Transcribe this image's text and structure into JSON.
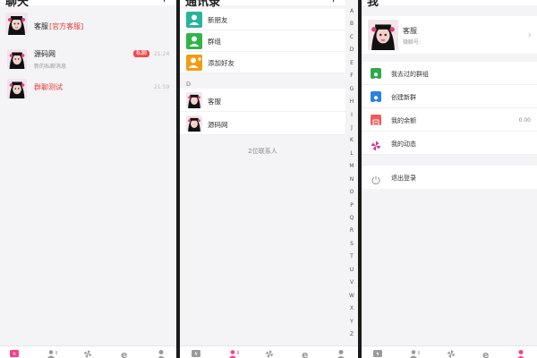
{
  "chats_screen": {
    "title": "聊天",
    "conversations": [
      {
        "name": "客服",
        "tag": "[官方客服]",
        "subtitle": "",
        "time": "",
        "badge": ""
      },
      {
        "name": "源码网",
        "tag": "",
        "subtitle": "新的私聊消息",
        "time": "21:24",
        "badge": "私聊"
      },
      {
        "name": "群聊测试",
        "tag": "",
        "subtitle": "",
        "time": "21:59",
        "badge": ""
      }
    ]
  },
  "contacts_screen": {
    "title": "通讯录",
    "function_items": [
      {
        "label": "新朋友",
        "color": "#27b39c"
      },
      {
        "label": "群组",
        "color": "#31b447"
      },
      {
        "label": "添加好友",
        "color": "#f39c12"
      }
    ],
    "section_letter": "D",
    "contacts": [
      {
        "label": "客服"
      },
      {
        "label": "源码网"
      }
    ],
    "contact_count": "2位联系人",
    "index_letters": [
      "A",
      "B",
      "C",
      "D",
      "E",
      "F",
      "G",
      "H",
      "I",
      "J",
      "K",
      "L",
      "M",
      "N",
      "O",
      "P",
      "Q",
      "R",
      "S",
      "T",
      "U",
      "V",
      "W",
      "X",
      "Y",
      "Z"
    ]
  },
  "me_screen": {
    "title": "我",
    "profile": {
      "name": "客服",
      "id_label": "微聊号:"
    },
    "menu": [
      {
        "label": "我去过的群组",
        "value": "",
        "color": "#2eaa4a"
      },
      {
        "label": "创建新群",
        "value": "",
        "color": "#2a82e4"
      },
      {
        "label": "我的余额",
        "value": "0.00",
        "color": "#ef5b5b"
      },
      {
        "label": "我的动态",
        "value": "",
        "color": "#d6348f"
      }
    ],
    "logout_label": "退出登录"
  },
  "colors": {
    "accent": "#ff3d8b",
    "tab_inactive": "#9a9a9a"
  }
}
